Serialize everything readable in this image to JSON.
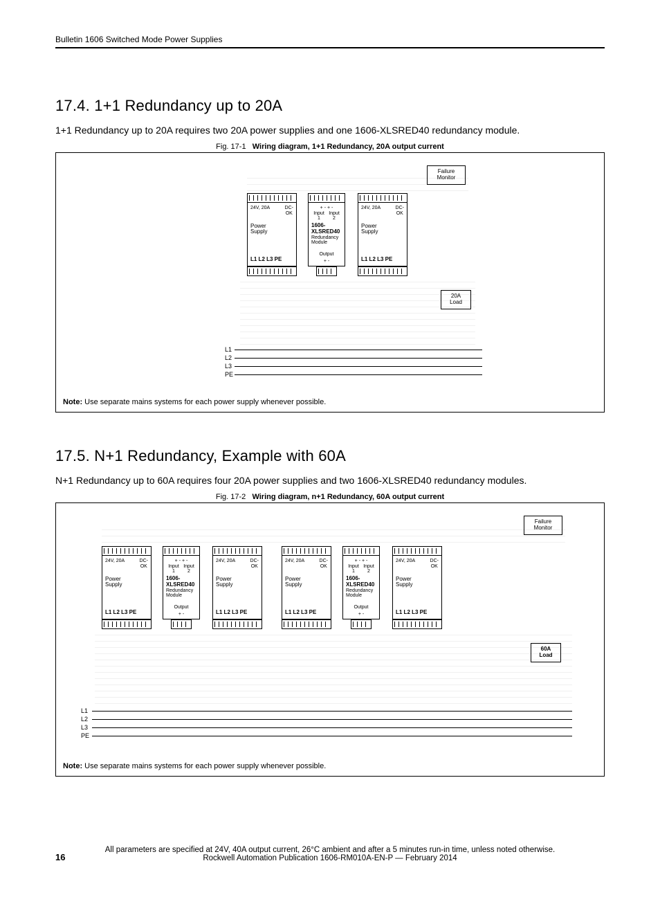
{
  "header": "Bulletin 1606 Switched Mode Power Supplies",
  "section1": {
    "title": "17.4. 1+1 Redundancy up to 20A",
    "body": "1+1 Redundancy up to 20A requires two 20A power supplies and one 1606-XLSRED40 redundancy module.",
    "fig_label": "Fig. 17-1",
    "fig_title": "Wiring diagram, 1+1 Redundancy, 20A output current",
    "note_label": "Note:",
    "note_text": "Use separate mains systems for each power supply whenever possible."
  },
  "section2": {
    "title": "17.5. N+1 Redundancy, Example with 60A",
    "body": "N+1 Redundancy up to 60A requires four 20A power supplies and two 1606-XLSRED40 redundancy modules.",
    "fig_label": "Fig. 17-2",
    "fig_title": "Wiring diagram, n+1 Redundancy, 60A output current",
    "note_label": "Note:",
    "note_text": "Use separate mains systems for each power supply whenever possible."
  },
  "diagram": {
    "failure_monitor": "Failure\nMonitor",
    "ps_term_top": "+ +  - -",
    "ps_rating": "24V, 20A",
    "dc_ok": "DC-\nOK",
    "power_supply": "Power\nSupply",
    "ps_term_bottom": "L1 L2 L3 PE",
    "red_inputs": "+ - + -",
    "input1": "Input\n1",
    "input2": "Input\n2",
    "red_model": "1606-\nXLSRED40",
    "red_desc": "Redundancy\nModule",
    "output": "Output",
    "output_polarity": "+    -",
    "load20": "20A\nLoad",
    "load60": "60A\nLoad",
    "rails": {
      "l1": "L1",
      "l2": "L2",
      "l3": "L3",
      "pe": "PE"
    }
  },
  "footer": {
    "spec": "All parameters are specified at 24V, 40A output current, 26°C ambient and after a 5 minutes run-in time, unless noted otherwise.",
    "pub": "Rockwell Automation Publication 1606-RM010A-EN-P — February 2014",
    "page": "16"
  }
}
